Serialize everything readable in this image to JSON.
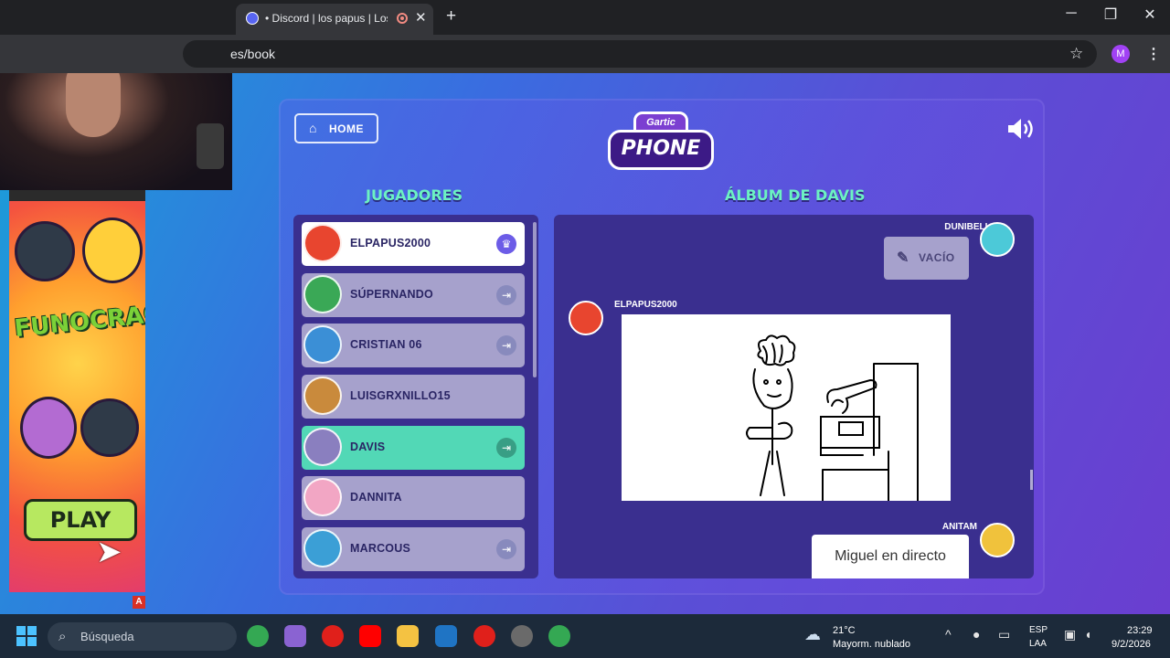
{
  "browser": {
    "tab_title": "• Discord | los papus | Los p",
    "tab_close": "✕",
    "new_tab": "+",
    "url": "es/book",
    "window_controls": {
      "minimize": "─",
      "maximize": "❐",
      "close": "✕"
    },
    "star_icon": "☆",
    "profile_initial": "M",
    "menu_icon": "⋮"
  },
  "ad": {
    "logo_text": "FUNOCRACY",
    "play_label": "PLAY",
    "badge": "A"
  },
  "game": {
    "home_label": "HOME",
    "home_icon": "⌂",
    "logo_small": "Gartic",
    "logo_big": "PHONE",
    "players_title": "JUGADORES",
    "album_title": "ÁLBUM DE DAVIS",
    "players": [
      {
        "name": "ELPAPUS2000",
        "avatar_color": "#e8452f",
        "action_icon": "♛"
      },
      {
        "name": "SÚPERNANDO",
        "avatar_color": "#3aa856",
        "action_icon": "⇥"
      },
      {
        "name": "CRISTIAN 06",
        "avatar_color": "#3b8fd6",
        "action_icon": "⇥"
      },
      {
        "name": "LUISGRXNILLO15",
        "avatar_color": "#c98a3c",
        "action_icon": ""
      },
      {
        "name": "DAVIS",
        "avatar_color": "#8a7fbf",
        "action_icon": "⇥"
      },
      {
        "name": "DANNITA",
        "avatar_color": "#f2a6c4",
        "action_icon": ""
      },
      {
        "name": "MARCOUS",
        "avatar_color": "#3b9fd6",
        "action_icon": "⇥"
      }
    ],
    "album": {
      "dunibella_name": "DUNIBELLA",
      "empty_label": "VACÍO",
      "pencil_icon": "✎",
      "elpapus_name": "ELPAPUS2000",
      "anitam_name": "ANITAM",
      "answer": "Miguel en directo"
    }
  },
  "taskbar": {
    "search_label": "Búsqueda",
    "search_icon": "⌕",
    "weather_icon": "☁",
    "temperature": "21°C",
    "condition": "Mayorm. nublado",
    "chevron": "^",
    "lang_top": "ESP",
    "lang_bottom": "LAA",
    "time": "23:29",
    "date": "9/2/2026",
    "apps": [
      {
        "name": "chrome",
        "color": "#34a853"
      },
      {
        "name": "copilot",
        "color": "#8a63d2"
      },
      {
        "name": "opera",
        "color": "#e0201b"
      },
      {
        "name": "youtube",
        "color": "#ff0000"
      },
      {
        "name": "file-explorer",
        "color": "#f4c242"
      },
      {
        "name": "visual-studio",
        "color": "#1f74c4"
      },
      {
        "name": "opera-gx",
        "color": "#e0201b"
      },
      {
        "name": "obs",
        "color": "#6a6a6a"
      },
      {
        "name": "chrome-profile",
        "color": "#34a853"
      }
    ]
  }
}
